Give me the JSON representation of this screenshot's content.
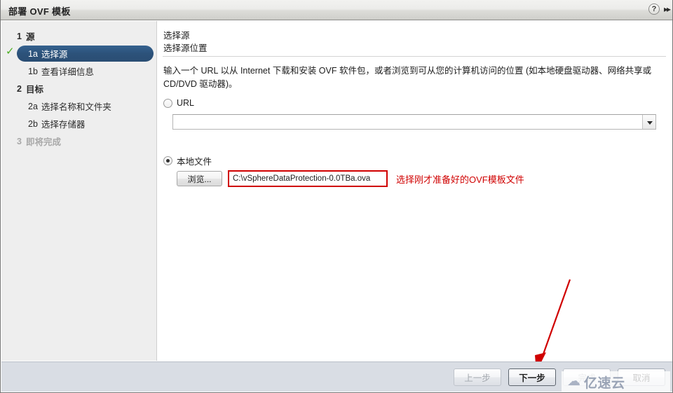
{
  "window": {
    "title": "部署 OVF 模板",
    "help_icon": "help-icon",
    "expand_icon": "double-chevron-right-icon"
  },
  "sidebar": {
    "items": [
      {
        "num": "1",
        "label": "源",
        "level": "top",
        "state": "normal",
        "checked": false
      },
      {
        "num": "1a",
        "label": "选择源",
        "level": "sub",
        "state": "active",
        "checked": true
      },
      {
        "num": "1b",
        "label": "查看详细信息",
        "level": "sub",
        "state": "normal",
        "checked": false
      },
      {
        "num": "2",
        "label": "目标",
        "level": "top",
        "state": "normal",
        "checked": false
      },
      {
        "num": "2a",
        "label": "选择名称和文件夹",
        "level": "sub",
        "state": "normal",
        "checked": false
      },
      {
        "num": "2b",
        "label": "选择存储器",
        "level": "sub",
        "state": "normal",
        "checked": false
      },
      {
        "num": "3",
        "label": "即将完成",
        "level": "top",
        "state": "disabled",
        "checked": false
      }
    ]
  },
  "main": {
    "title": "选择源",
    "subtitle": "选择源位置",
    "description": "输入一个 URL 以从 Internet 下载和安装 OVF 软件包，或者浏览到可从您的计算机访问的位置 (如本地硬盘驱动器、网络共享或 CD/DVD 驱动器)。",
    "url_option": {
      "label": "URL",
      "selected": false,
      "value": "",
      "placeholder": ""
    },
    "local_option": {
      "label": "本地文件",
      "selected": true,
      "browse_label": "浏览...",
      "path_value": "C:\\vSphereDataProtection-0.0TBa.ova"
    },
    "annotation": {
      "text": "选择刚才准备好的OVF模板文件",
      "color": "#d00000"
    }
  },
  "footer": {
    "buttons": [
      {
        "label": "上一步",
        "state": "disabled"
      },
      {
        "label": "下一步",
        "state": "primary"
      },
      {
        "label": "完成",
        "state": "disabled"
      },
      {
        "label": "取消",
        "state": "normal"
      }
    ]
  },
  "watermark": {
    "text": "亿速云",
    "icon": "cloud-icon"
  }
}
